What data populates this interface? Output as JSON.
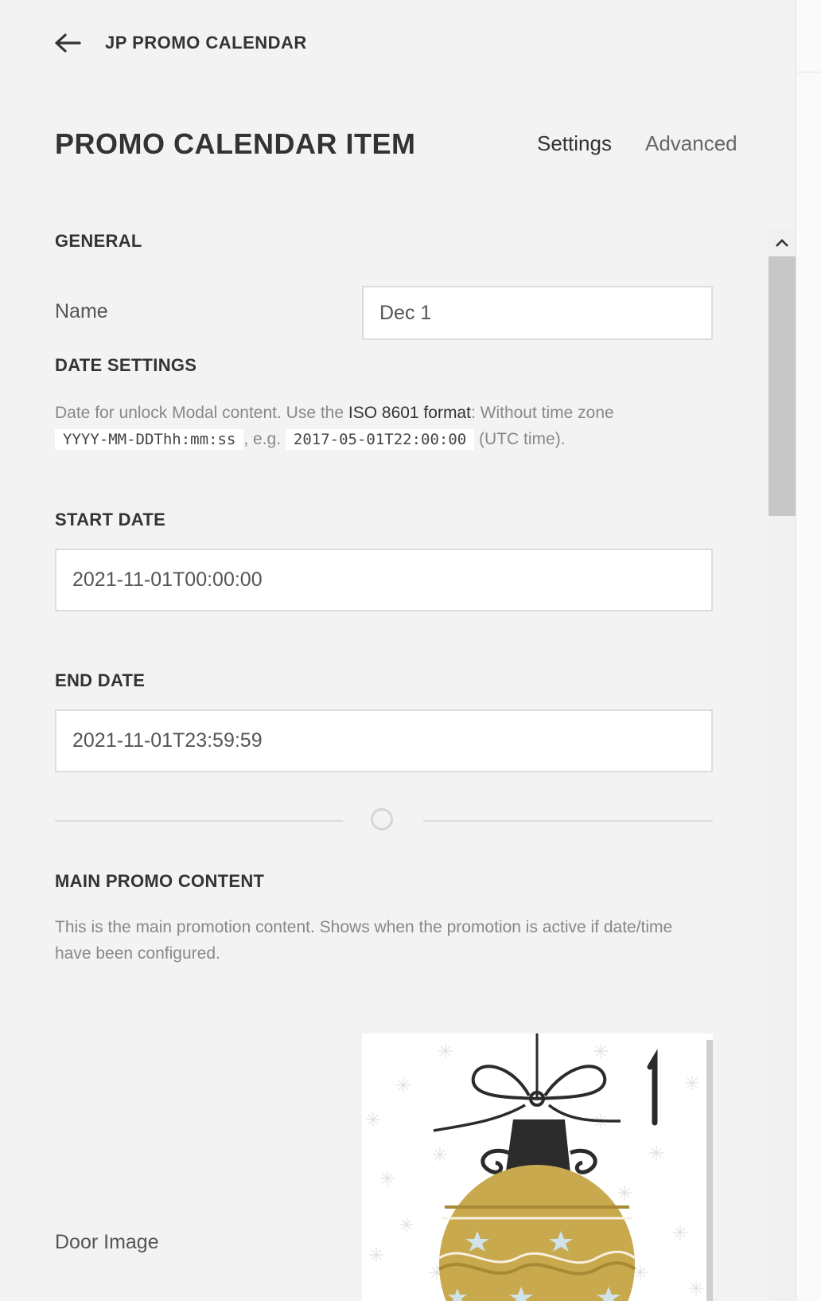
{
  "header": {
    "back_icon": "arrow-left-icon",
    "title": "JP PROMO CALENDAR"
  },
  "page": {
    "title": "PROMO CALENDAR ITEM",
    "tabs": [
      {
        "label": "Settings",
        "active": true
      },
      {
        "label": "Advanced",
        "active": false
      }
    ]
  },
  "general": {
    "heading": "GENERAL",
    "name_label": "Name",
    "name_value": "Dec 1"
  },
  "date_settings": {
    "heading": "DATE SETTINGS",
    "help_part1": "Date for unlock Modal content. Use the ",
    "help_link": "ISO 8601 format",
    "help_part2": ": Without time zone",
    "format_code": "YYYY-MM-DDThh:mm:ss",
    "help_part3": ", e.g. ",
    "example_code": "2017-05-01T22:00:00",
    "help_part4": " (UTC time)."
  },
  "start_date": {
    "heading": "START DATE",
    "value": "2021-11-01T00:00:00"
  },
  "end_date": {
    "heading": "END DATE",
    "value": "2021-11-01T23:59:59"
  },
  "main_promo": {
    "heading": "MAIN PROMO CONTENT",
    "help": "This is the main promotion content. Shows when the promotion is active if date/time have been configured.",
    "door_image_label": "Door Image",
    "door_number": "1"
  },
  "colors": {
    "background": "#f3f3f3",
    "ornament_gold": "#c9a94d",
    "ornament_dark": "#2b2b2b",
    "star_blue": "#cfe3e8"
  }
}
